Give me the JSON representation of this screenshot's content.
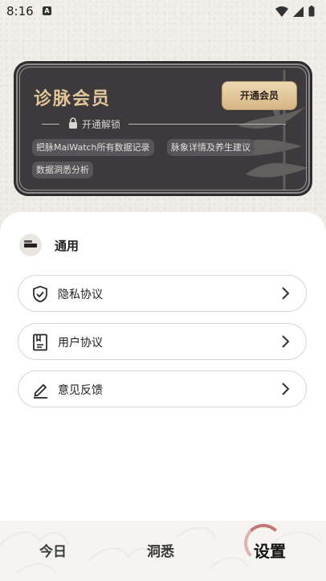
{
  "status_bar": {
    "time": "8:16",
    "badge": "A"
  },
  "vip_card": {
    "title": "诊脉会员",
    "button_label": "开通会员",
    "unlock_label": "开通解锁",
    "features": [
      "把脉MaiWatch所有数据记录",
      "脉象详情及养生建议",
      "数据洞悉分析"
    ]
  },
  "general": {
    "title": "通用",
    "items": [
      {
        "label": "隐私协议",
        "icon": "shield-check-icon"
      },
      {
        "label": "用户协议",
        "icon": "document-icon"
      },
      {
        "label": "意见反馈",
        "icon": "edit-icon"
      }
    ]
  },
  "tabs": [
    {
      "label": "今日",
      "active": false
    },
    {
      "label": "洞悉",
      "active": false
    },
    {
      "label": "设置",
      "active": true
    }
  ],
  "colors": {
    "gold": "#e2c699",
    "card_bg": "#3c3a3d",
    "accent_ring": "#b85757"
  }
}
